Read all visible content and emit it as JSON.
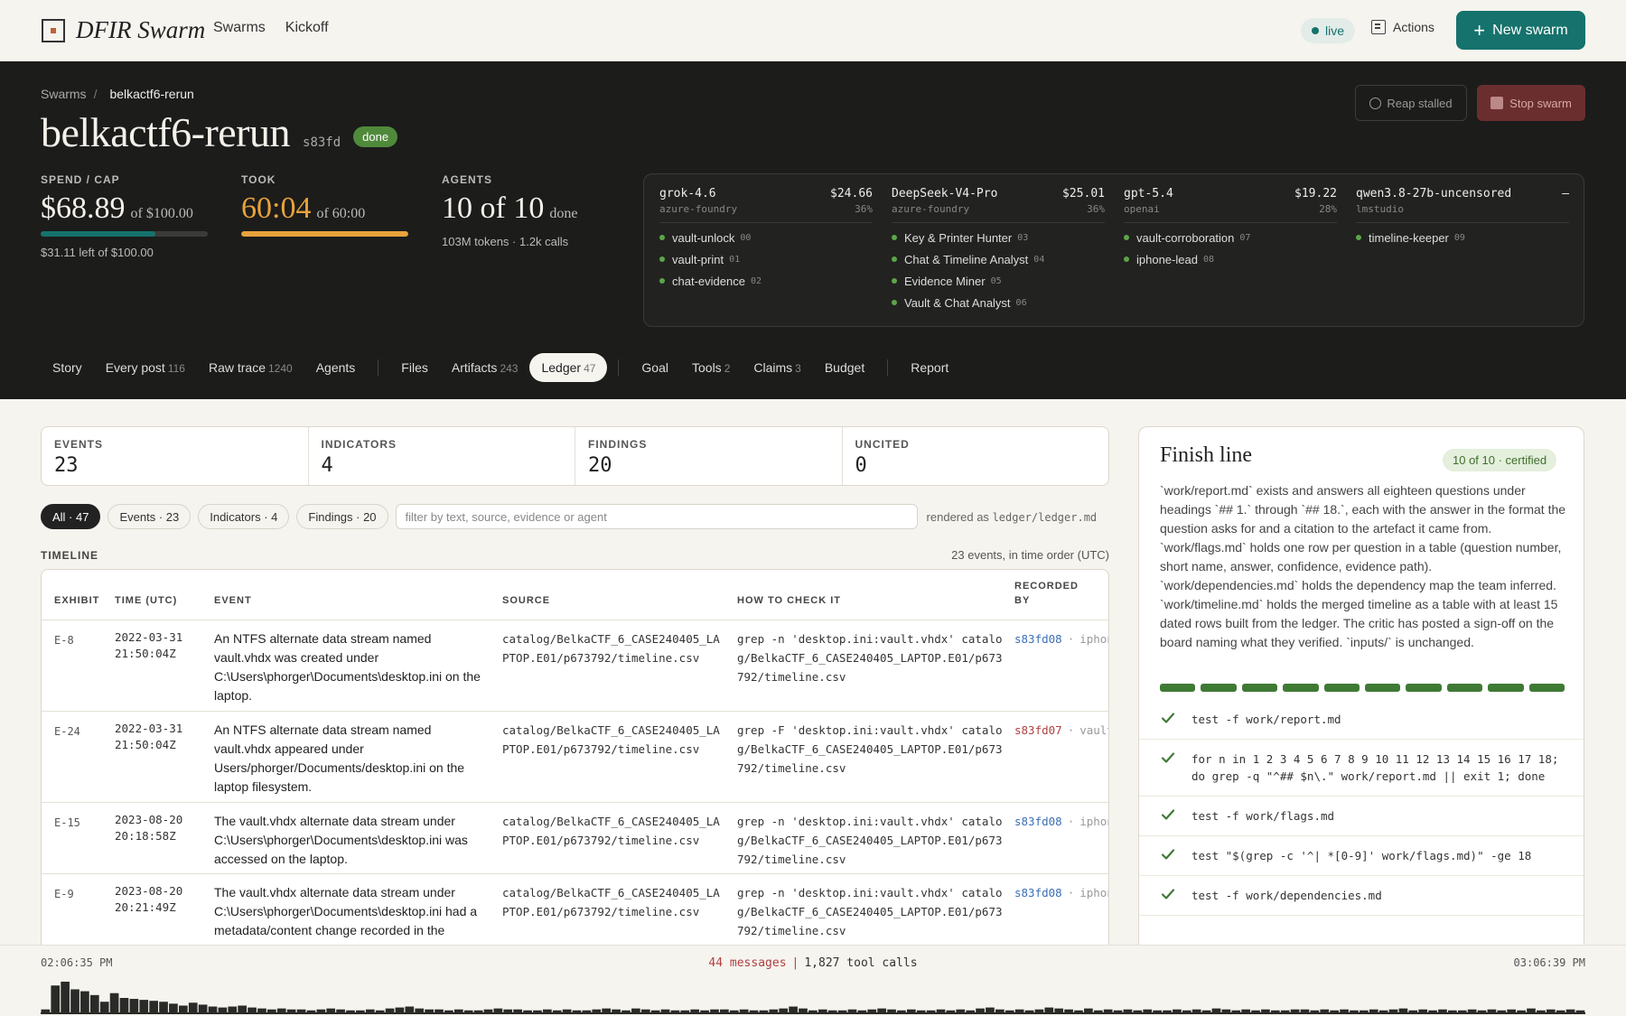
{
  "topbar": {
    "brand": "DFIR Swarm",
    "nav": [
      "Swarms",
      "Kickoff"
    ],
    "live": "live",
    "actions": "Actions",
    "new_swarm": "New swarm"
  },
  "hero": {
    "crumb_root": "Swarms",
    "crumb_sep": "/",
    "crumb_current": "belkactf6-rerun",
    "title": "belkactf6-rerun",
    "hash": "s83fd",
    "status": "done",
    "reap": "Reap stalled",
    "stop": "Stop swarm",
    "spend": {
      "label": "SPEND / CAP",
      "value": "$68.89",
      "of": "of $100.00",
      "sub": "$31.11 left of $100.00",
      "fill_pct": 68.89,
      "color": "#16726c"
    },
    "took": {
      "label": "TOOK",
      "value": "60:04",
      "of": "of 60:00",
      "fill_pct": 100,
      "color": "#e8a23c"
    },
    "agents": {
      "label": "AGENTS",
      "value": "10 of 10",
      "of": "done",
      "sub": "103M tokens · 1.2k calls"
    }
  },
  "models": [
    {
      "name": "grok-4.6",
      "cost": "$24.66",
      "provider": "azure-foundry",
      "pct": "36%",
      "agents": [
        {
          "name": "vault-unlock",
          "num": "00"
        },
        {
          "name": "vault-print",
          "num": "01"
        },
        {
          "name": "chat-evidence",
          "num": "02"
        }
      ]
    },
    {
      "name": "DeepSeek-V4-Pro",
      "cost": "$25.01",
      "provider": "azure-foundry",
      "pct": "36%",
      "agents": [
        {
          "name": "Key & Printer Hunter",
          "num": "03"
        },
        {
          "name": "Chat & Timeline Analyst",
          "num": "04"
        },
        {
          "name": "Evidence Miner",
          "num": "05"
        },
        {
          "name": "Vault & Chat Analyst",
          "num": "06"
        }
      ]
    },
    {
      "name": "gpt-5.4",
      "cost": "$19.22",
      "provider": "openai",
      "pct": "28%",
      "agents": [
        {
          "name": "vault-corroboration",
          "num": "07"
        },
        {
          "name": "iphone-lead",
          "num": "08"
        }
      ]
    },
    {
      "name": "qwen3.8-27b-uncensored",
      "cost": "–",
      "provider": "lmstudio",
      "pct": "",
      "agents": [
        {
          "name": "timeline-keeper",
          "num": "09"
        }
      ]
    }
  ],
  "tabs": [
    {
      "label": "Story",
      "count": ""
    },
    {
      "label": "Every post",
      "count": "116"
    },
    {
      "label": "Raw trace",
      "count": "1240"
    },
    {
      "label": "Agents",
      "count": ""
    },
    {
      "label": "Files",
      "count": ""
    },
    {
      "label": "Artifacts",
      "count": "243"
    },
    {
      "label": "Ledger",
      "count": "47"
    },
    {
      "label": "Goal",
      "count": ""
    },
    {
      "label": "Tools",
      "count": "2"
    },
    {
      "label": "Claims",
      "count": "3"
    },
    {
      "label": "Budget",
      "count": ""
    },
    {
      "label": "Report",
      "count": ""
    }
  ],
  "ledger_stats": [
    {
      "label": "EVENTS",
      "value": "23"
    },
    {
      "label": "INDICATORS",
      "value": "4"
    },
    {
      "label": "FINDINGS",
      "value": "20"
    },
    {
      "label": "UNCITED",
      "value": "0"
    }
  ],
  "filters": {
    "chips": [
      "All · 47",
      "Events · 23",
      "Indicators · 4",
      "Findings · 20"
    ],
    "placeholder": "filter by text, source, evidence or agent",
    "rendered_prefix": "rendered as",
    "rendered_path": "ledger/ledger.md"
  },
  "timeline": {
    "label": "TIMELINE",
    "count": "23 events, in time order (UTC)",
    "headers": [
      "EXHIBIT",
      "TIME (UTC)",
      "EVENT",
      "SOURCE",
      "HOW TO CHECK IT",
      "RECORDED BY"
    ],
    "rows": [
      {
        "exhibit": "E-8",
        "time": "2022-03-31 21:50:04Z",
        "event": "An NTFS alternate data stream named vault.vhdx was created under C:\\Users\\phorger\\Documents\\desktop.ini on the laptop.",
        "source": "catalog/BelkaCTF_6_CASE240405_LAPTOP.E01/p673792/timeline.csv",
        "check": "grep -n 'desktop.ini:vault.vhdx' catalog/BelkaCTF_6_CASE240405_LAPTOP.E01/p673792/timeline.csv",
        "rec_hash": "s83fd08",
        "rec_agent": "iphone-lead"
      },
      {
        "exhibit": "E-24",
        "time": "2022-03-31 21:50:04Z",
        "event": "An NTFS alternate data stream named vault.vhdx appeared under Users/phorger/Documents/desktop.ini on the laptop filesystem.",
        "source": "catalog/BelkaCTF_6_CASE240405_LAPTOP.E01/p673792/timeline.csv",
        "check": "grep -F 'desktop.ini:vault.vhdx' catalog/BelkaCTF_6_CASE240405_LAPTOP.E01/p673792/timeline.csv",
        "rec_hash": "s83fd07",
        "rec_agent": "vault-corroboration"
      },
      {
        "exhibit": "E-15",
        "time": "2023-08-20 20:18:58Z",
        "event": "The vault.vhdx alternate data stream under C:\\Users\\phorger\\Documents\\desktop.ini was accessed on the laptop.",
        "source": "catalog/BelkaCTF_6_CASE240405_LAPTOP.E01/p673792/timeline.csv",
        "check": "grep -n 'desktop.ini:vault.vhdx' catalog/BelkaCTF_6_CASE240405_LAPTOP.E01/p673792/timeline.csv",
        "rec_hash": "s83fd08",
        "rec_agent": "iphone-lead"
      },
      {
        "exhibit": "E-9",
        "time": "2023-08-20 20:21:49Z",
        "event": "The vault.vhdx alternate data stream under C:\\Users\\phorger\\Documents\\desktop.ini had a metadata/content change recorded in the",
        "source": "catalog/BelkaCTF_6_CASE240405_LAPTOP.E01/p673792/timeline.csv",
        "check": "grep -n 'desktop.ini:vault.vhdx' catalog/BelkaCTF_6_CASE240405_LAPTOP.E01/p673792/timeline.csv",
        "rec_hash": "s83fd08",
        "rec_agent": "iphone-lead"
      }
    ]
  },
  "finish": {
    "title": "Finish line",
    "badge": "10 of 10 · certified",
    "text": "`work/report.md` exists and answers all eighteen questions under headings `## 1.` through `## 18.`, each with the answer in the format the question asks for and a citation to the artefact it came from. `work/flags.md` holds one row per question in a table (question number, short name, answer, confidence, evidence path). `work/dependencies.md` holds the dependency map the team inferred. `work/timeline.md` holds the merged timeline as a table with at least 15 dated rows built from the ledger. The critic has posted a sign-off on the board naming what they verified. `inputs/` is unchanged.",
    "segments_done": 10,
    "segments_total": 10,
    "checks": [
      "test -f work/report.md",
      "for n in 1 2 3 4 5 6 7 8 9 10 11 12 13 14 15 16 17 18; do grep -q \"^## $n\\.\" work/report.md || exit 1; done",
      "test -f work/flags.md",
      "test \"$(grep -c '^| *[0-9]' work/flags.md)\" -ge 18",
      "test -f work/dependencies.md"
    ]
  },
  "bottom": {
    "start": "02:06:35 PM",
    "end": "03:06:39 PM",
    "messages": "44 messages",
    "sep": "|",
    "tool_calls": "1,827 tool calls",
    "histogram": [
      5,
      30,
      34,
      26,
      24,
      20,
      13,
      22,
      17,
      16,
      15,
      14,
      13,
      11,
      9,
      12,
      10,
      8,
      7,
      8,
      9,
      7,
      6,
      5,
      6,
      5,
      5,
      4,
      5,
      6,
      5,
      4,
      4,
      5,
      4,
      6,
      7,
      8,
      6,
      5,
      5,
      4,
      5,
      4,
      4,
      5,
      6,
      5,
      5,
      4,
      4,
      5,
      4,
      5,
      4,
      4,
      5,
      6,
      5,
      4,
      6,
      5,
      4,
      5,
      4,
      4,
      5,
      4,
      5,
      5,
      4,
      5,
      4,
      4,
      5,
      6,
      8,
      6,
      4,
      5,
      4,
      4,
      5,
      4,
      5,
      6,
      5,
      4,
      5,
      4,
      4,
      5,
      4,
      5,
      4,
      6,
      7,
      5,
      4,
      5,
      4,
      5,
      7,
      6,
      5,
      4,
      6,
      4,
      5,
      4,
      5,
      4,
      5,
      4,
      4,
      5,
      4,
      5,
      4,
      6,
      5,
      4,
      5,
      4,
      5,
      4,
      4,
      5,
      5,
      4,
      5,
      4,
      5,
      4,
      4,
      5,
      4,
      5,
      6,
      4,
      5,
      4,
      5,
      4,
      4,
      5,
      4,
      5,
      4,
      5,
      4,
      6,
      4,
      5,
      4,
      5,
      4
    ]
  }
}
